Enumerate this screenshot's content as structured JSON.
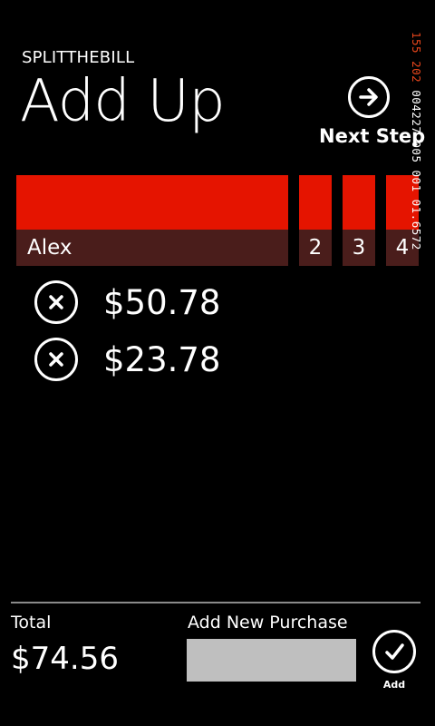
{
  "app": {
    "title": "SPLITTHEBILL",
    "page_title": "Add Up",
    "accent_color": "#e51400",
    "tile_dark_color": "#4a1d1b"
  },
  "header": {
    "next_step_label": "Next Step",
    "next_step_icon": "arrow-right-circle-icon"
  },
  "people": [
    {
      "label": "Alex"
    },
    {
      "label": "2"
    },
    {
      "label": "3"
    },
    {
      "label": "4"
    }
  ],
  "purchases": [
    {
      "amount": "$50.78",
      "icon": "remove-circle-icon"
    },
    {
      "amount": "$23.78",
      "icon": "remove-circle-icon"
    }
  ],
  "footer": {
    "total_label": "Total",
    "total_value": "$74.56",
    "add_purchase_label": "Add New Purchase",
    "add_purchase_value": "",
    "add_button_label": "Add",
    "add_icon": "checkmark-circle-icon"
  },
  "debug_overlay": {
    "part1": "155",
    "part2": "202",
    "part3": "004227",
    "part4": "005",
    "part5": "001",
    "part6": "01.6572"
  }
}
